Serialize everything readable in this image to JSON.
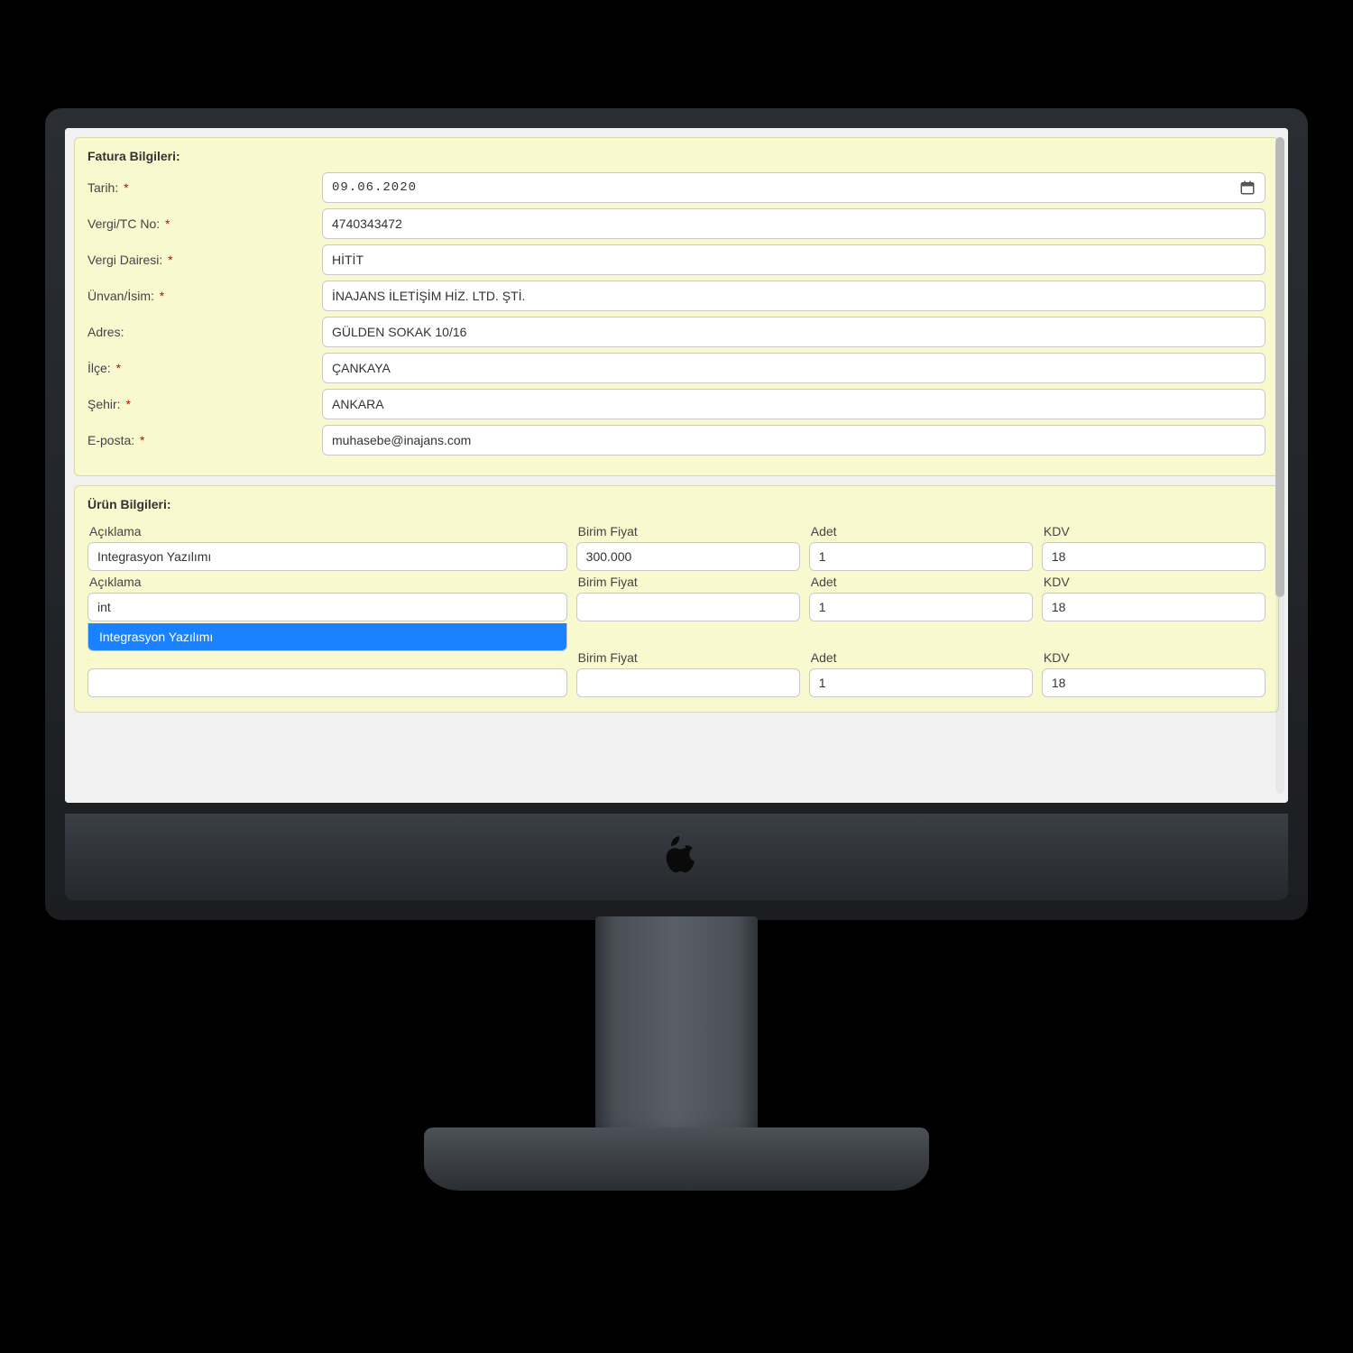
{
  "invoice": {
    "section_title": "Fatura Bilgileri:",
    "fields": {
      "date": {
        "label": "Tarih:",
        "required": true,
        "value": "09.06.2020"
      },
      "tax_no": {
        "label": "Vergi/TC No:",
        "required": true,
        "value": "4740343472"
      },
      "tax_office": {
        "label": "Vergi Dairesi:",
        "required": true,
        "value": "HİTİT"
      },
      "title_name": {
        "label": "Ünvan/İsim:",
        "required": true,
        "value": "İNAJANS İLETİŞİM HİZ. LTD. ŞTİ."
      },
      "address": {
        "label": "Adres:",
        "required": false,
        "value": "GÜLDEN SOKAK 10/16"
      },
      "district": {
        "label": "İlçe:",
        "required": true,
        "value": "ÇANKAYA"
      },
      "city": {
        "label": "Şehir:",
        "required": true,
        "value": "ANKARA"
      },
      "email": {
        "label": "E-posta:",
        "required": true,
        "value": "muhasebe@inajans.com"
      }
    }
  },
  "products": {
    "section_title": "Ürün Bilgileri:",
    "columns": {
      "desc": "Açıklama",
      "unit_price": "Birim Fiyat",
      "qty": "Adet",
      "vat": "KDV"
    },
    "rows": [
      {
        "desc": "Integrasyon Yazılımı",
        "unit_price": "300.000",
        "qty": "1",
        "vat": "18"
      },
      {
        "desc": "int",
        "unit_price": "",
        "qty": "1",
        "vat": "18",
        "autocomplete": {
          "selected": "Integrasyon Yazılımı"
        }
      },
      {
        "desc": "",
        "unit_price": "",
        "qty": "1",
        "vat": "18"
      }
    ]
  }
}
